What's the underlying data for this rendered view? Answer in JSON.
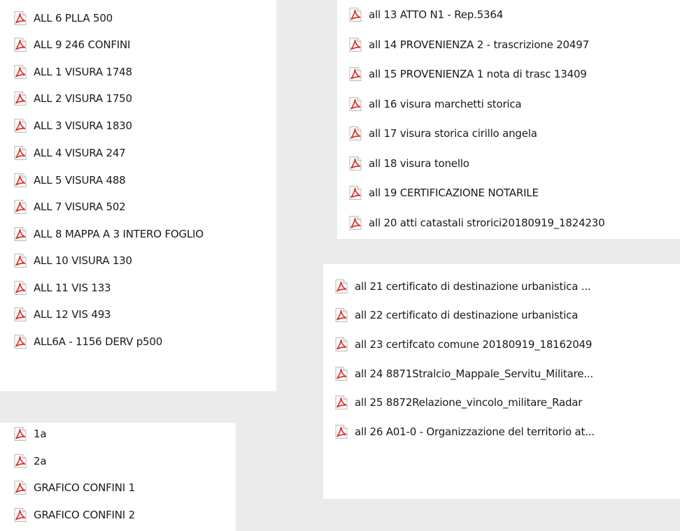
{
  "files_left_top": [
    {
      "name": "ALL  6  PLLA 500"
    },
    {
      "name": "ALL  9 246 CONFINI"
    },
    {
      "name": "ALL 1 VISURA 1748"
    },
    {
      "name": "ALL 2 VISURA 1750"
    },
    {
      "name": "ALL 3 VISURA 1830"
    },
    {
      "name": "ALL 4 VISURA 247"
    },
    {
      "name": "ALL 5 VISURA 488"
    },
    {
      "name": "ALL 7 VISURA 502"
    },
    {
      "name": "ALL 8 MAPPA A 3 INTERO FOGLIO"
    },
    {
      "name": "ALL 10 VISURA 130"
    },
    {
      "name": "ALL 11 VIS 133"
    },
    {
      "name": "ALL 12 VIS 493"
    },
    {
      "name": "ALL6A - 1156 DERV p500"
    }
  ],
  "files_left_bottom": [
    {
      "name": "1a"
    },
    {
      "name": "2a"
    },
    {
      "name": "GRAFICO CONFINI 1"
    },
    {
      "name": "GRAFICO CONFINI 2"
    }
  ],
  "files_right_top": [
    {
      "name": "all 13 ATTO N1 - Rep.5364"
    },
    {
      "name": "all 14 PROVENIENZA 2 - trascrizione 20497"
    },
    {
      "name": "all 15 PROVENIENZA 1 nota di trasc 13409"
    },
    {
      "name": "all 16 visura marchetti storica"
    },
    {
      "name": "all 17 visura storica cirillo angela"
    },
    {
      "name": "all 18 visura tonello"
    },
    {
      "name": "all 19 CERTIFICAZIONE NOTARILE"
    },
    {
      "name": "all 20 atti catastali strorici20180919_1824230"
    }
  ],
  "files_right_bottom": [
    {
      "name": "all 21  certificato di destinazione urbanistica ..."
    },
    {
      "name": "all 22 certificato di destinazione urbanistica"
    },
    {
      "name": "all 23 certifcato comune 20180919_18162049"
    },
    {
      "name": "all 24 8871Stralcio_Mappale_Servitu_Militare..."
    },
    {
      "name": "all 25 8872Relazione_vincolo_militare_Radar"
    },
    {
      "name": "all 26 A01-0 - Organizzazione del territorio at..."
    }
  ],
  "icon": {
    "name": "pdf-file-icon",
    "accent": "#d9322b"
  }
}
